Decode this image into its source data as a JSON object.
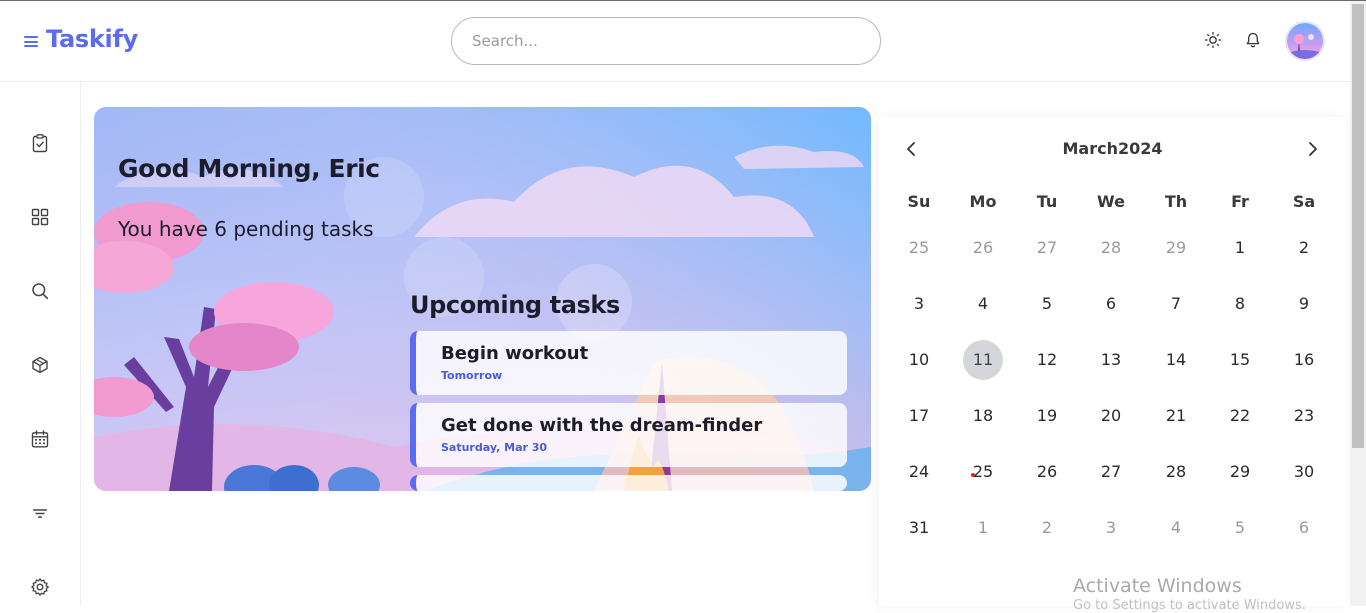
{
  "app": {
    "brand": "Taskify"
  },
  "search": {
    "placeholder": "Search..."
  },
  "header": {
    "icons": [
      "sun-icon",
      "bell-icon",
      "avatar"
    ]
  },
  "sidebar": {
    "icons": [
      "clipboard-check-icon",
      "grid-icon",
      "search-icon",
      "cube-icon",
      "calendar-icon",
      "filter-icon",
      "gear-icon"
    ]
  },
  "hero": {
    "greeting": "Good Morning, Eric",
    "pending": "You have 6 pending tasks",
    "upcoming_title": "Upcoming tasks",
    "tasks": [
      {
        "title": "Begin workout",
        "date": "Tomorrow"
      },
      {
        "title": "Get done with the dream-finder",
        "date": "Saturday, Mar 30"
      }
    ]
  },
  "calendar": {
    "title": "March2024",
    "weekdays": [
      "Su",
      "Mo",
      "Tu",
      "We",
      "Th",
      "Fr",
      "Sa"
    ],
    "weeks": [
      [
        "25",
        "26",
        "27",
        "28",
        "29",
        "1",
        "2"
      ],
      [
        "3",
        "4",
        "5",
        "6",
        "7",
        "8",
        "9"
      ],
      [
        "10",
        "11",
        "12",
        "13",
        "14",
        "15",
        "16"
      ],
      [
        "17",
        "18",
        "19",
        "20",
        "21",
        "22",
        "23"
      ],
      [
        "24",
        "25",
        "26",
        "27",
        "28",
        "29",
        "30"
      ],
      [
        "31",
        "1",
        "2",
        "3",
        "4",
        "5",
        "6"
      ]
    ],
    "selected": "11",
    "marked": "25"
  },
  "watermark": {
    "title": "Activate Windows",
    "subtitle": "Go to Settings to activate Windows."
  },
  "colors": {
    "accent": "#5b6cf0",
    "dot": "#e02424"
  }
}
